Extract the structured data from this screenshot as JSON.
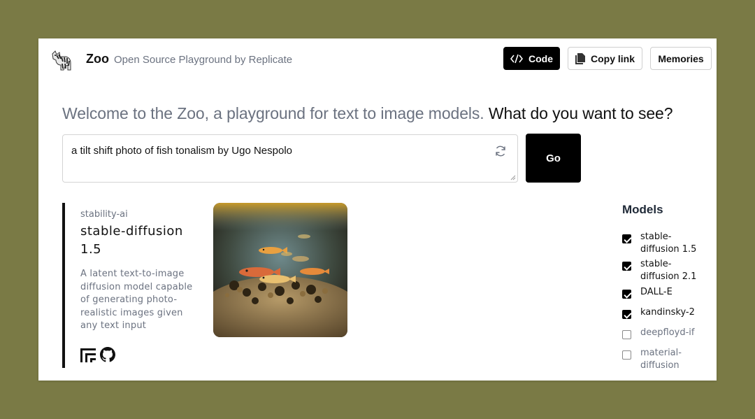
{
  "header": {
    "brand": "Zoo",
    "tagline": "Open Source Playground by Replicate",
    "code_label": "Code",
    "copy_link_label": "Copy link",
    "memories_label": "Memories"
  },
  "headline": {
    "lead": "Welcome to the Zoo, a playground for text to image models.",
    "question": "What do you want to see?"
  },
  "prompt": {
    "value": "a tilt shift photo of fish tonalism by Ugo Nespolo",
    "go_label": "Go"
  },
  "result": {
    "owner": "stability-ai",
    "model": "stable-diffusion 1.5",
    "description": "A latent text-to-image diffusion model capable of generating photo-realistic images given any text input"
  },
  "models": {
    "title": "Models",
    "items": [
      {
        "label": "stable-diffusion 1.5",
        "checked": true
      },
      {
        "label": "stable-diffusion 2.1",
        "checked": true
      },
      {
        "label": "DALL-E",
        "checked": true
      },
      {
        "label": "kandinsky-2",
        "checked": true
      },
      {
        "label": "deepfloyd-if",
        "checked": false
      },
      {
        "label": "material-diffusion",
        "checked": false
      }
    ]
  },
  "colors": {
    "background": "#7a7a45",
    "primary": "#000000",
    "muted_text": "#6b7280"
  }
}
